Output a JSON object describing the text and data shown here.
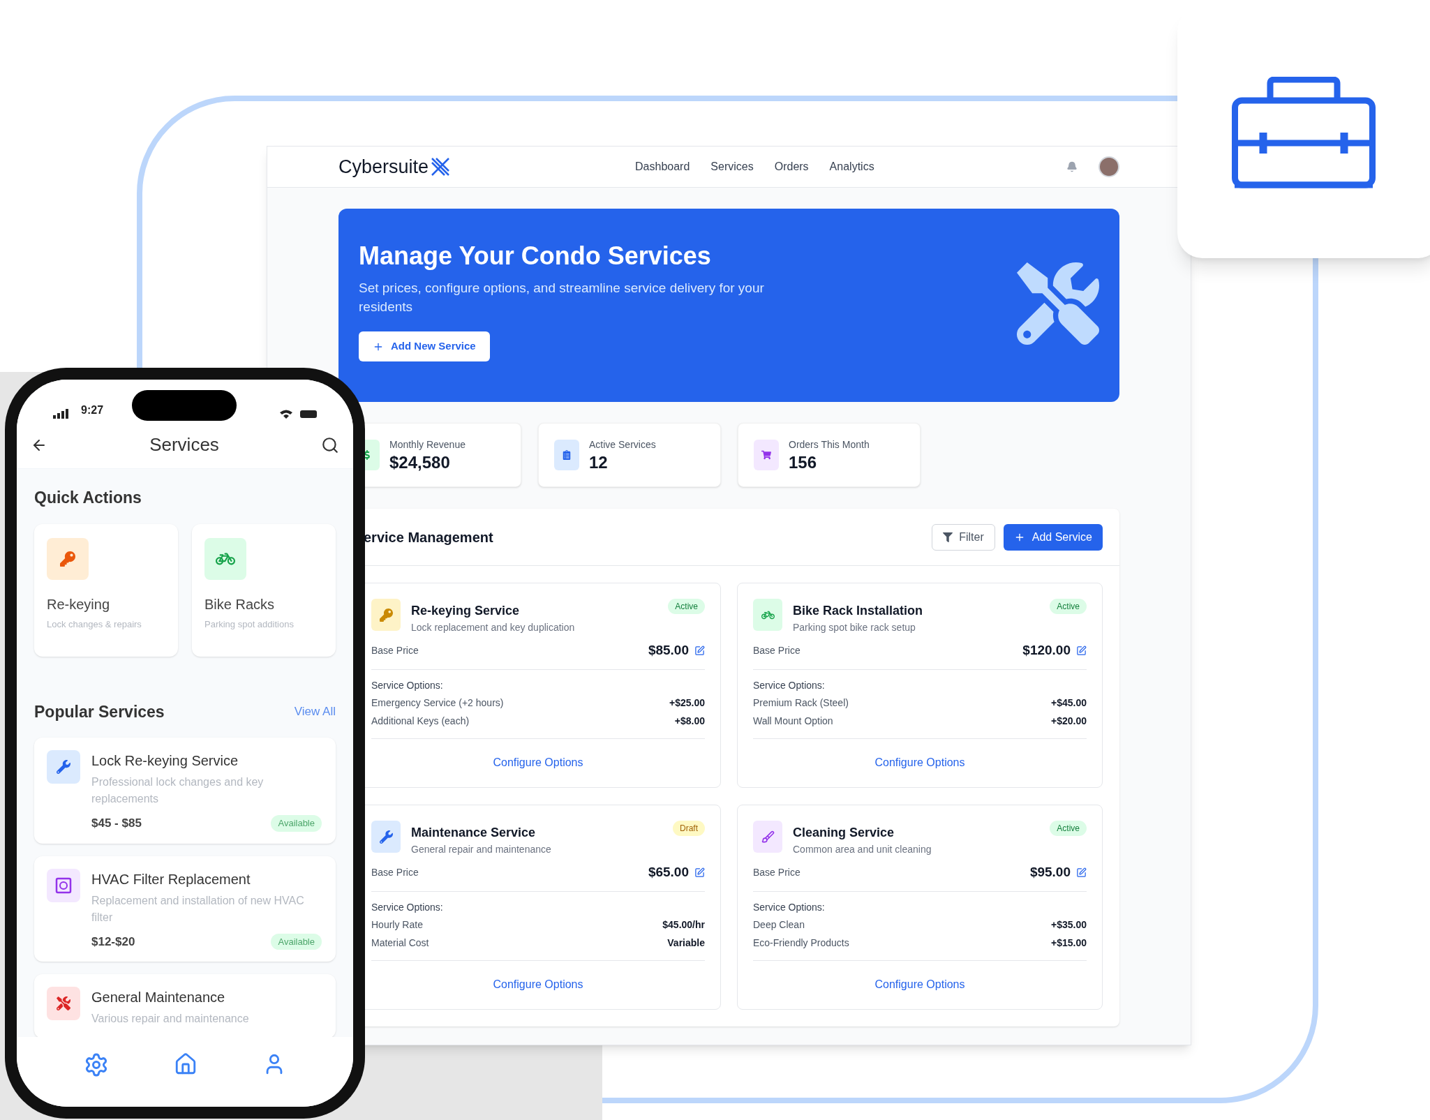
{
  "logo": {
    "text": "Cybersuite"
  },
  "nav": [
    "Dashboard",
    "Services",
    "Orders",
    "Analytics"
  ],
  "banner": {
    "title": "Manage Your Condo Services",
    "subtitle": "Set prices, configure options, and streamline service delivery for your residents",
    "button": "Add New Service"
  },
  "stats": [
    {
      "kind": "revenue",
      "label": "Monthly Revenue",
      "value": "$24,580"
    },
    {
      "kind": "services",
      "label": "Active Services",
      "value": "12"
    },
    {
      "kind": "orders",
      "label": "Orders This Month",
      "value": "156"
    }
  ],
  "management": {
    "title": "ervice Management",
    "filter_button": "Filter",
    "add_button": "Add Service"
  },
  "services": [
    {
      "kind": "key",
      "name": "Re-keying Service",
      "description": "Lock replacement and key duplication",
      "status": {
        "kind": "active",
        "label": "Active"
      },
      "price_label": "Base Price",
      "price": "$85.00",
      "options_heading": "Service Options:",
      "options": [
        {
          "label": "Emergency Service (+2 hours)",
          "value": "+$25.00"
        },
        {
          "label": "Additional Keys (each)",
          "value": "+$8.00"
        }
      ],
      "configure": "Configure Options"
    },
    {
      "kind": "bike",
      "name": "Bike Rack Installation",
      "description": "Parking spot bike rack setup",
      "status": {
        "kind": "active",
        "label": "Active"
      },
      "price_label": "Base Price",
      "price": "$120.00",
      "options_heading": "Service Options:",
      "options": [
        {
          "label": "Premium Rack (Steel)",
          "value": "+$45.00"
        },
        {
          "label": "Wall Mount Option",
          "value": "+$20.00"
        }
      ],
      "configure": "Configure Options"
    },
    {
      "kind": "wrench",
      "name": "Maintenance Service",
      "description": "General repair and maintenance",
      "status": {
        "kind": "draft",
        "label": "Draft"
      },
      "price_label": "Base Price",
      "price": "$65.00",
      "options_heading": "Service Options:",
      "options": [
        {
          "label": "Hourly Rate",
          "value": "$45.00/hr"
        },
        {
          "label": "Material Cost",
          "value": "Variable"
        }
      ],
      "configure": "Configure Options"
    },
    {
      "kind": "brush",
      "name": "Cleaning Service",
      "description": "Common area and unit cleaning",
      "status": {
        "kind": "active",
        "label": "Active"
      },
      "price_label": "Base Price",
      "price": "$95.00",
      "options_heading": "Service Options:",
      "options": [
        {
          "label": "Deep Clean",
          "value": "+$35.00"
        },
        {
          "label": "Eco-Friendly Products",
          "value": "+$15.00"
        }
      ],
      "configure": "Configure Options"
    }
  ],
  "phone": {
    "time": "9:27",
    "title": "Services",
    "quick_title": "Quick Actions",
    "quick_actions": [
      {
        "kind": "key",
        "title": "Re-keying",
        "subtitle": "Lock changes & repairs"
      },
      {
        "kind": "bike",
        "title": "Bike Racks",
        "subtitle": "Parking spot additions"
      }
    ],
    "popular_title": "Popular Services",
    "view_all": "View All",
    "popular": [
      {
        "kind": "wrench",
        "title": "Lock Re-keying Service",
        "description": "Professional lock changes and key replacements",
        "price": "$45 - $85",
        "badge": "Available"
      },
      {
        "kind": "filter",
        "title": "HVAC Filter Replacement",
        "description": "Replacement and installation of new HVAC filter",
        "price": "$12-$20",
        "badge": "Available"
      },
      {
        "kind": "tools",
        "title": "General Maintenance",
        "description": "Various repair and maintenance"
      }
    ]
  }
}
